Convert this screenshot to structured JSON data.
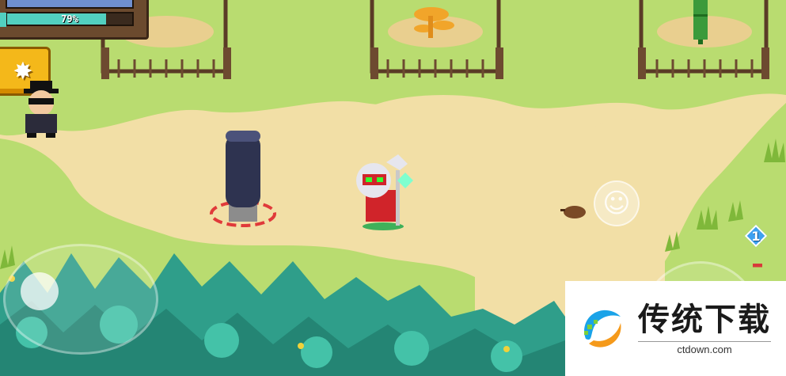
{
  "hud": {
    "health_text": "",
    "health_fraction": 1.0,
    "energy_text": "79%",
    "energy_fraction": 0.79
  },
  "buff_button": {
    "icon": "star-burst-icon"
  },
  "emote_button": {
    "icon": "smiley-face-icon",
    "glyph": "☺"
  },
  "skill_charges": {
    "count": "1"
  },
  "joystick": {
    "label": ""
  },
  "attack_button": {
    "icon": "sword-icon"
  },
  "watermark": {
    "title": "传统下载",
    "url": "ctdown.com"
  },
  "colors": {
    "grass": "#b9dc70",
    "sand": "#f2dfa6",
    "forest": "#2f9e8a",
    "fence": "#5a3b26",
    "accent_gold": "#f4b81a"
  }
}
